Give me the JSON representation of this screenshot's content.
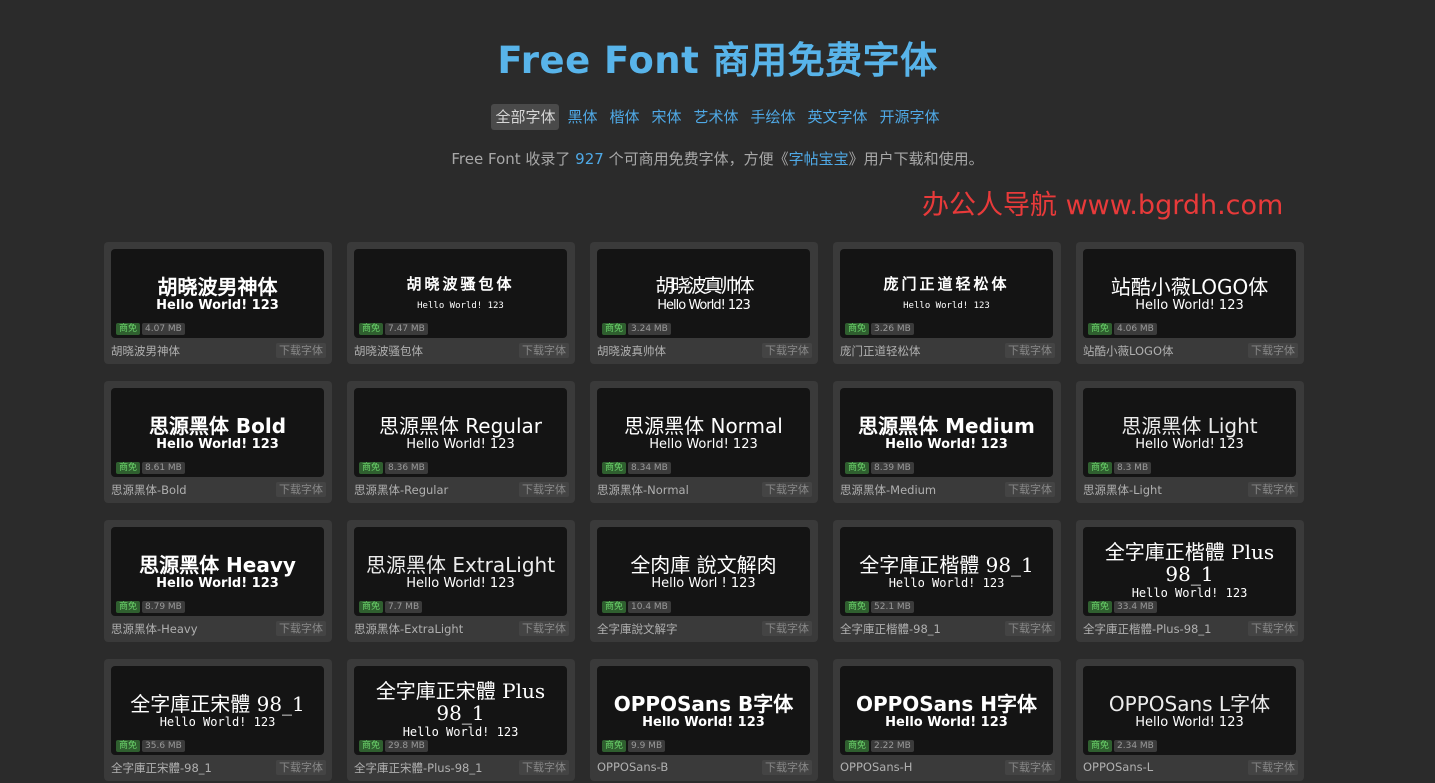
{
  "header": {
    "title": "Free Font 商用免费字体",
    "nav": [
      "全部字体",
      "黑体",
      "楷体",
      "宋体",
      "艺术体",
      "手绘体",
      "英文字体",
      "开源字体"
    ],
    "active_nav": 0,
    "desc_prefix": "Free Font 收录了 ",
    "desc_count": "927",
    "desc_mid": " 个可商用免费字体，方便《",
    "desc_link": "字帖宝宝",
    "desc_suffix": "》用户下载和使用。",
    "watermark": "办公人导航 www.bgrdh.com"
  },
  "common": {
    "badge": "商免",
    "download": "下载字体"
  },
  "fonts": [
    {
      "title": "胡晓波男神体",
      "sub": "Hello World! 123",
      "size": "4.07 MB",
      "name": "胡晓波男神体",
      "style": "bold"
    },
    {
      "title": "胡晓波骚包体",
      "sub": "Hello World! 123",
      "size": "7.47 MB",
      "name": "胡晓波骚包体",
      "style": "mono-small"
    },
    {
      "title": "胡晓波真帅体",
      "sub": "Hello World! 123",
      "size": "3.24 MB",
      "name": "胡晓波真帅体",
      "style": "condensed"
    },
    {
      "title": "庞门正道轻松体",
      "sub": "Hello World! 123",
      "size": "3.26 MB",
      "name": "庞门正道轻松体",
      "style": "mono-small"
    },
    {
      "title": "站酷小薇LOGO体",
      "sub": "Hello World! 123",
      "size": "4.06 MB",
      "name": "站酷小薇LOGO体",
      "style": "normal"
    },
    {
      "title": "思源黑体 Bold",
      "sub": "Hello World! 123",
      "size": "8.61 MB",
      "name": "思源黑体-Bold",
      "style": "bold"
    },
    {
      "title": "思源黑体 Regular",
      "sub": "Hello World! 123",
      "size": "8.36 MB",
      "name": "思源黑体-Regular",
      "style": "normal"
    },
    {
      "title": "思源黑体 Normal",
      "sub": "Hello World! 123",
      "size": "8.34 MB",
      "name": "思源黑体-Normal",
      "style": "normal"
    },
    {
      "title": "思源黑体 Medium",
      "sub": "Hello World! 123",
      "size": "8.39 MB",
      "name": "思源黑体-Medium",
      "style": "bold"
    },
    {
      "title": "思源黑体 Light",
      "sub": "Hello World! 123",
      "size": "8.3 MB",
      "name": "思源黑体-Light",
      "style": "light"
    },
    {
      "title": "思源黑体 Heavy",
      "sub": "Hello World! 123",
      "size": "8.79 MB",
      "name": "思源黑体-Heavy",
      "style": "bold"
    },
    {
      "title": "思源黑体 ExtraLight",
      "sub": "Hello World! 123",
      "size": "7.7 MB",
      "name": "思源黑体-ExtraLight",
      "style": "light"
    },
    {
      "title": "全肉庫 說文解肉",
      "sub": "Hello Worl   ! 123",
      "size": "10.4 MB",
      "name": "全字庫說文解字",
      "style": "normal"
    },
    {
      "title": "全字庫正楷體 98_1",
      "sub": "Hello World! 123",
      "size": "52.1 MB",
      "name": "全字庫正楷體-98_1",
      "style": "serif"
    },
    {
      "title": "全字庫正楷體 Plus 98_1",
      "sub": "Hello World! 123",
      "size": "33.4 MB",
      "name": "全字庫正楷體-Plus-98_1",
      "style": "serif-wrap"
    },
    {
      "title": "全字庫正宋體 98_1",
      "sub": "Hello World! 123",
      "size": "35.6 MB",
      "name": "全字庫正宋體-98_1",
      "style": "serif"
    },
    {
      "title": "全字庫正宋體 Plus 98_1",
      "sub": "Hello World! 123",
      "size": "29.8 MB",
      "name": "全字庫正宋體-Plus-98_1",
      "style": "serif-wrap"
    },
    {
      "title": "OPPOSans B字体",
      "sub": "Hello World! 123",
      "size": "9.9 MB",
      "name": "OPPOSans-B",
      "style": "bold"
    },
    {
      "title": "OPPOSans H字体",
      "sub": "Hello World! 123",
      "size": "2.22 MB",
      "name": "OPPOSans-H",
      "style": "bold"
    },
    {
      "title": "OPPOSans L字体",
      "sub": "Hello World! 123",
      "size": "2.34 MB",
      "name": "OPPOSans-L",
      "style": "light"
    }
  ]
}
